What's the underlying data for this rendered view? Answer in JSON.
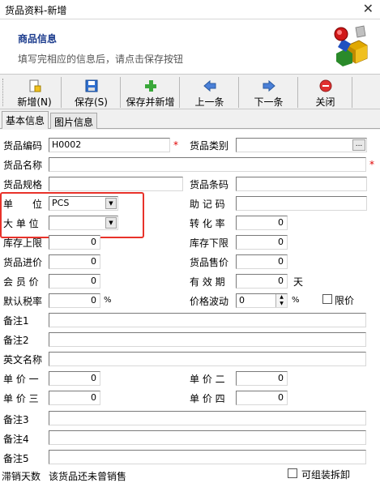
{
  "window": {
    "title": "货品资料-新增",
    "close_glyph": "✕"
  },
  "header": {
    "title": "商品信息",
    "subtitle": "填写完相应的信息后，请点击保存按钮"
  },
  "toolbar": {
    "new_label": "新增(N)",
    "save_label": "保存(S)",
    "save_new_label": "保存并新增",
    "prev_label": "上一条",
    "next_label": "下一条",
    "close_label": "关闭"
  },
  "tabs": {
    "basic": "基本信息",
    "image": "图片信息"
  },
  "form": {
    "code_label": "货品编码",
    "code_value": "H0002",
    "category_label": "货品类别",
    "category_value": "",
    "name_label": "货品名称",
    "name_value": "",
    "spec_label": "货品规格",
    "spec_value": "",
    "barcode_label": "货品条码",
    "barcode_value": "",
    "unit_label": "单　　位",
    "unit_value": "PCS",
    "mnemonic_label": "助 记 码",
    "mnemonic_value": "",
    "big_unit_label": "大 单 位",
    "big_unit_value": "",
    "conversion_label": "转 化 率",
    "conversion_value": "0",
    "stock_max_label": "库存上限",
    "stock_max_value": "0",
    "stock_min_label": "库存下限",
    "stock_min_value": "0",
    "purchase_price_label": "货品进价",
    "purchase_price_value": "0",
    "sale_price_label": "货品售价",
    "sale_price_value": "0",
    "member_price_label": "会 员 价",
    "member_price_value": "0",
    "validity_label": "有 效 期",
    "validity_value": "0",
    "validity_unit": "天",
    "tax_label": "默认税率",
    "tax_value": "0",
    "tax_unit": "%",
    "price_fluct_label": "价格波动",
    "price_fluct_value": "0",
    "price_fluct_unit": "%",
    "limit_price_label": "限价",
    "remark1_label": "备注1",
    "remark2_label": "备注2",
    "english_name_label": "英文名称",
    "price1_label": "单 价 一",
    "price1_value": "0",
    "price2_label": "单 价 二",
    "price2_value": "0",
    "price3_label": "单 价 三",
    "price3_value": "0",
    "price4_label": "单 价 四",
    "price4_value": "0",
    "remark3_label": "备注3",
    "remark4_label": "备注4",
    "remark5_label": "备注5",
    "slow_days_label": "滞销天数",
    "slow_days_value": "该货品还未曾销售",
    "assemble_label": "可组装拆卸",
    "required_mark": "*"
  },
  "colors": {
    "header_title": "#1a3a8c",
    "required": "#e00000",
    "highlight_box": "#e8322a"
  }
}
